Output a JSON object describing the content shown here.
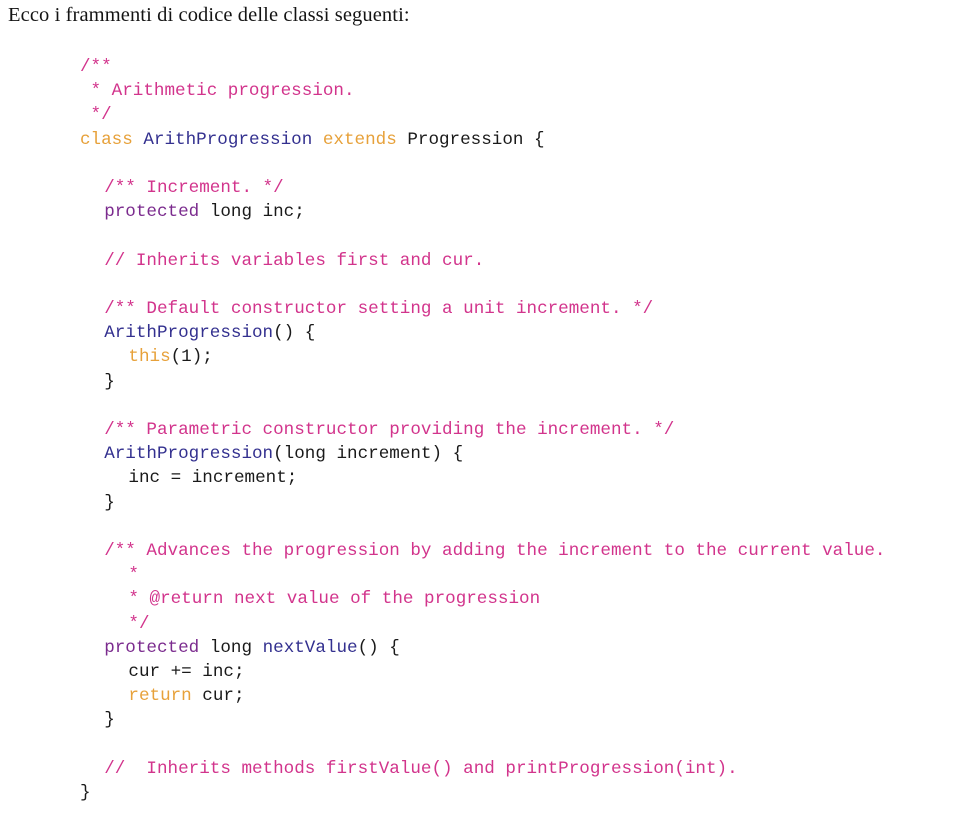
{
  "page": {
    "intro_text": "Ecco i frammenti di codice delle classi seguenti:",
    "language": "java",
    "colors": {
      "comment": "#d2348c",
      "keyword": "#e7a13a",
      "modifier": "#7b2b8e",
      "type_name": "#33308f",
      "plain": "#1a1a1a",
      "background": "#ffffff"
    }
  },
  "code": {
    "lines": [
      {
        "id": "l1",
        "indent": 0,
        "tokens": [
          {
            "t": "/**",
            "c": "cmt"
          }
        ]
      },
      {
        "id": "l2",
        "indent": 0,
        "tokens": [
          {
            "t": " * Arithmetic progression.",
            "c": "cmt"
          }
        ]
      },
      {
        "id": "l3",
        "indent": 0,
        "tokens": [
          {
            "t": " */",
            "c": "cmt"
          }
        ]
      },
      {
        "id": "l4",
        "indent": 0,
        "tokens": [
          {
            "t": "class",
            "c": "kw"
          },
          {
            "t": " ",
            "c": "plain"
          },
          {
            "t": "ArithProgression",
            "c": "type"
          },
          {
            "t": " ",
            "c": "plain"
          },
          {
            "t": "extends",
            "c": "kw"
          },
          {
            "t": " Progression {",
            "c": "plain"
          }
        ]
      },
      {
        "id": "l5",
        "indent": 0,
        "blank": true,
        "tokens": []
      },
      {
        "id": "l6",
        "indent": 1,
        "tokens": [
          {
            "t": "/** Increment. */",
            "c": "cmt"
          }
        ]
      },
      {
        "id": "l7",
        "indent": 1,
        "tokens": [
          {
            "t": "protected",
            "c": "mod"
          },
          {
            "t": " long inc;",
            "c": "plain"
          }
        ]
      },
      {
        "id": "l8",
        "indent": 0,
        "blank": true,
        "tokens": []
      },
      {
        "id": "l9",
        "indent": 1,
        "tokens": [
          {
            "t": "// Inherits variables first and cur.",
            "c": "cmt"
          }
        ]
      },
      {
        "id": "l10",
        "indent": 0,
        "blank": true,
        "tokens": []
      },
      {
        "id": "l11",
        "indent": 1,
        "tokens": [
          {
            "t": "/** Default constructor setting a unit increment. */",
            "c": "cmt"
          }
        ]
      },
      {
        "id": "l12",
        "indent": 1,
        "tokens": [
          {
            "t": "ArithProgression",
            "c": "type"
          },
          {
            "t": "() {",
            "c": "plain"
          }
        ]
      },
      {
        "id": "l13",
        "indent": 2,
        "tokens": [
          {
            "t": "this",
            "c": "kw"
          },
          {
            "t": "(1);",
            "c": "plain"
          }
        ]
      },
      {
        "id": "l14",
        "indent": 1,
        "tokens": [
          {
            "t": "}",
            "c": "plain"
          }
        ]
      },
      {
        "id": "l15",
        "indent": 0,
        "blank": true,
        "tokens": []
      },
      {
        "id": "l16",
        "indent": 1,
        "tokens": [
          {
            "t": "/** Parametric constructor providing the increment. */",
            "c": "cmt"
          }
        ]
      },
      {
        "id": "l17",
        "indent": 1,
        "tokens": [
          {
            "t": "ArithProgression",
            "c": "type"
          },
          {
            "t": "(long increment) {",
            "c": "plain"
          }
        ]
      },
      {
        "id": "l18",
        "indent": 2,
        "tokens": [
          {
            "t": "inc = increment;",
            "c": "plain"
          }
        ]
      },
      {
        "id": "l19",
        "indent": 1,
        "tokens": [
          {
            "t": "}",
            "c": "plain"
          }
        ]
      },
      {
        "id": "l20",
        "indent": 0,
        "blank": true,
        "tokens": []
      },
      {
        "id": "l21",
        "indent": 1,
        "wrap": true,
        "tokens": [
          {
            "t": "/** Advances the progression by adding the increment to the current value.",
            "c": "cmt"
          }
        ]
      },
      {
        "id": "l22",
        "indent": 2,
        "tokens": [
          {
            "t": "*",
            "c": "cmt"
          }
        ]
      },
      {
        "id": "l23",
        "indent": 2,
        "tokens": [
          {
            "t": "* @return next value of the progression",
            "c": "cmt"
          }
        ]
      },
      {
        "id": "l24",
        "indent": 2,
        "tokens": [
          {
            "t": "*/",
            "c": "cmt"
          }
        ]
      },
      {
        "id": "l25",
        "indent": 1,
        "tokens": [
          {
            "t": "protected",
            "c": "mod"
          },
          {
            "t": " long ",
            "c": "plain"
          },
          {
            "t": "nextValue",
            "c": "type"
          },
          {
            "t": "() {",
            "c": "plain"
          }
        ]
      },
      {
        "id": "l26",
        "indent": 2,
        "tokens": [
          {
            "t": "cur += inc;",
            "c": "plain"
          }
        ]
      },
      {
        "id": "l27",
        "indent": 2,
        "tokens": [
          {
            "t": "return",
            "c": "kw"
          },
          {
            "t": " cur;",
            "c": "plain"
          }
        ]
      },
      {
        "id": "l28",
        "indent": 1,
        "tokens": [
          {
            "t": "}",
            "c": "plain"
          }
        ]
      },
      {
        "id": "l29",
        "indent": 0,
        "blank": true,
        "tokens": []
      },
      {
        "id": "l30",
        "indent": 1,
        "tokens": [
          {
            "t": "//  Inherits methods firstValue() and printProgression(int).",
            "c": "cmt"
          }
        ]
      },
      {
        "id": "l31",
        "indent": 0,
        "tokens": [
          {
            "t": "}",
            "c": "plain"
          }
        ]
      }
    ]
  }
}
